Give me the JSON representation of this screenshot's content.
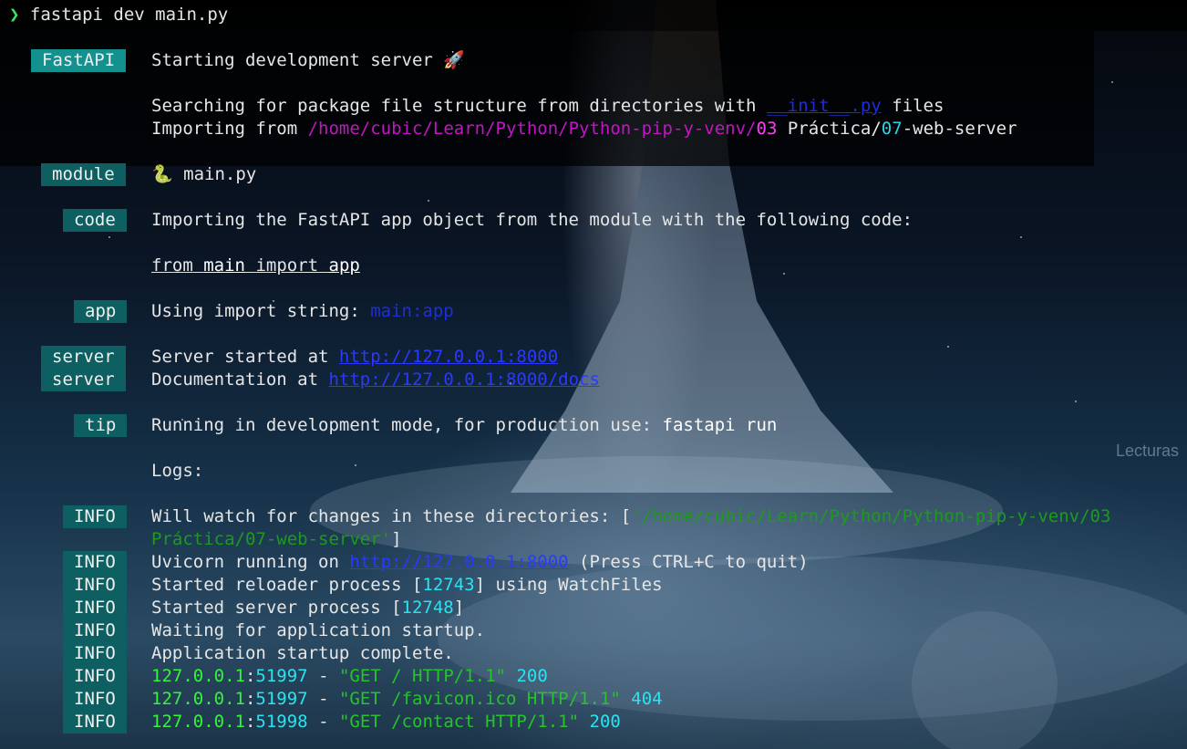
{
  "prompt": {
    "symbol": "❯",
    "command": "fastapi dev main.py"
  },
  "badges": {
    "fastapi": "FastAPI",
    "module": "module",
    "code": "code",
    "app": "app",
    "server": "server",
    "tip": "tip",
    "info": "INFO"
  },
  "messages": {
    "starting": "Starting development server",
    "rocket": "🚀",
    "searching_prefix": "Searching for package file structure from directories with",
    "init_file": "__init__.py",
    "searching_suffix": "files",
    "importing_from": "Importing from",
    "path_magenta": "/home/cubic/Learn/Python/Python-pip-y-venv/",
    "path_num_03": "03",
    "path_mid": "Práctica/",
    "path_num_07": "07",
    "path_end": "-web-server",
    "module_icon": "🐍",
    "module_name": "main.py",
    "code_intro": "Importing the FastAPI app object from the module with the following code:",
    "code_from": "from",
    "code_main": "main",
    "code_import": "import",
    "code_app": "app",
    "import_string_label": "Using import string:",
    "import_string_value": "main:app",
    "server_started": "Server started at",
    "server_url": "http://127.0.0.1:8000",
    "docs_label": "Documentation at",
    "docs_url": "http://127.0.0.1:8000/docs",
    "tip_text": "Running in development mode, for production use:",
    "tip_cmd": "fastapi run",
    "logs": "Logs:"
  },
  "logs": {
    "watch_prefix": "Will watch for changes in these directories: [",
    "watch_path_1": "'/home/cubic/Learn/Python/Python-pip-y-venv/03",
    "watch_path_2": "Práctica/07-web-server'",
    "watch_suffix": "]",
    "uvicorn_prefix": "Uvicorn running on",
    "uvicorn_url": "http://127.0.0.1:8000",
    "uvicorn_suffix": "(Press CTRL+C to quit)",
    "reloader_prefix": "Started reloader process [",
    "reloader_pid": "12743",
    "reloader_suffix": "] using WatchFiles",
    "server_prefix": "Started server process [",
    "server_pid": "12748",
    "server_suffix": "]",
    "waiting": "Waiting for application startup.",
    "complete": "Application startup complete.",
    "requests": [
      {
        "ip": "127.0.0.1",
        "port": "51997",
        "dash": "-",
        "request": "\"GET / HTTP/1.1\"",
        "status": "200"
      },
      {
        "ip": "127.0.0.1",
        "port": "51997",
        "dash": "-",
        "request": "\"GET /favicon.ico HTTP/1.1\"",
        "status": "404"
      },
      {
        "ip": "127.0.0.1",
        "port": "51998",
        "dash": "-",
        "request": "\"GET /contact HTTP/1.1\"",
        "status": "200"
      }
    ]
  },
  "background_text": {
    "lecturas": "Lecturas"
  },
  "colors": {
    "badge_bg": "#0d5f61",
    "badge_fastapi_bg": "#14908f",
    "prompt_arrow": "#3ee25a",
    "link": "#2b39ff",
    "path_magenta": "#c415c4",
    "number_cyan": "#2ed3e6",
    "ip_green": "#36f23c"
  }
}
